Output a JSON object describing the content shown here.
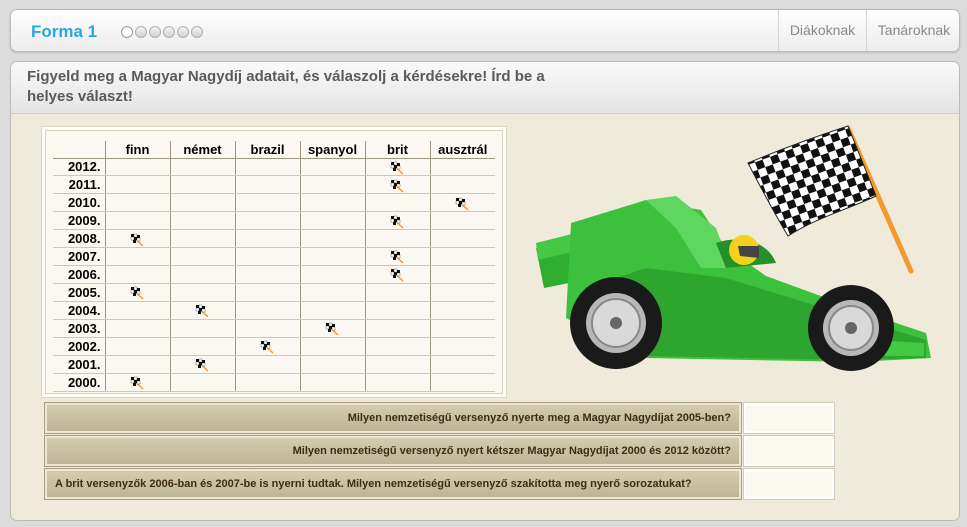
{
  "topbar": {
    "title": "Forma 1",
    "progress_steps": 6,
    "nav": [
      "Diákoknak",
      "Tanároknak"
    ]
  },
  "instruction": "Figyeld meg a Magyar Nagydíj adatait, és válaszolj a kérdésekre! Írd be a helyes választ!",
  "table": {
    "columns": [
      "finn",
      "német",
      "brazil",
      "spanyol",
      "brit",
      "ausztrál"
    ],
    "rows": [
      {
        "year": "2012.",
        "winner": "brit"
      },
      {
        "year": "2011.",
        "winner": "brit"
      },
      {
        "year": "2010.",
        "winner": "ausztrál"
      },
      {
        "year": "2009.",
        "winner": "brit"
      },
      {
        "year": "2008.",
        "winner": "finn"
      },
      {
        "year": "2007.",
        "winner": "brit"
      },
      {
        "year": "2006.",
        "winner": "brit"
      },
      {
        "year": "2005.",
        "winner": "finn"
      },
      {
        "year": "2004.",
        "winner": "német"
      },
      {
        "year": "2003.",
        "winner": "spanyol"
      },
      {
        "year": "2002.",
        "winner": "brazil"
      },
      {
        "year": "2001.",
        "winner": "német"
      },
      {
        "year": "2000.",
        "winner": "finn"
      }
    ]
  },
  "questions": [
    {
      "text": "Milyen nemzetiségű versenyző nyerte meg a Magyar Nagydíjat 2005-ben?",
      "value": ""
    },
    {
      "text": "Milyen nemzetiségű versenyző nyert kétszer Magyar Nagydíjat 2000 és 2012 között?",
      "value": ""
    },
    {
      "text": "A brit versenyzők 2006-ban és 2007-be is nyerni tudtak. Milyen nemzetiségű versenyző szakította meg nyerő sorozatukat?",
      "value": ""
    }
  ],
  "colors": {
    "title": "#2aa7e0",
    "panel_bg": "#f0eadb",
    "car_green": "#3cc13c",
    "flag_pole": "#f29a2e"
  },
  "icons": [
    "checkered-flag-icon",
    "race-car-illustration"
  ]
}
